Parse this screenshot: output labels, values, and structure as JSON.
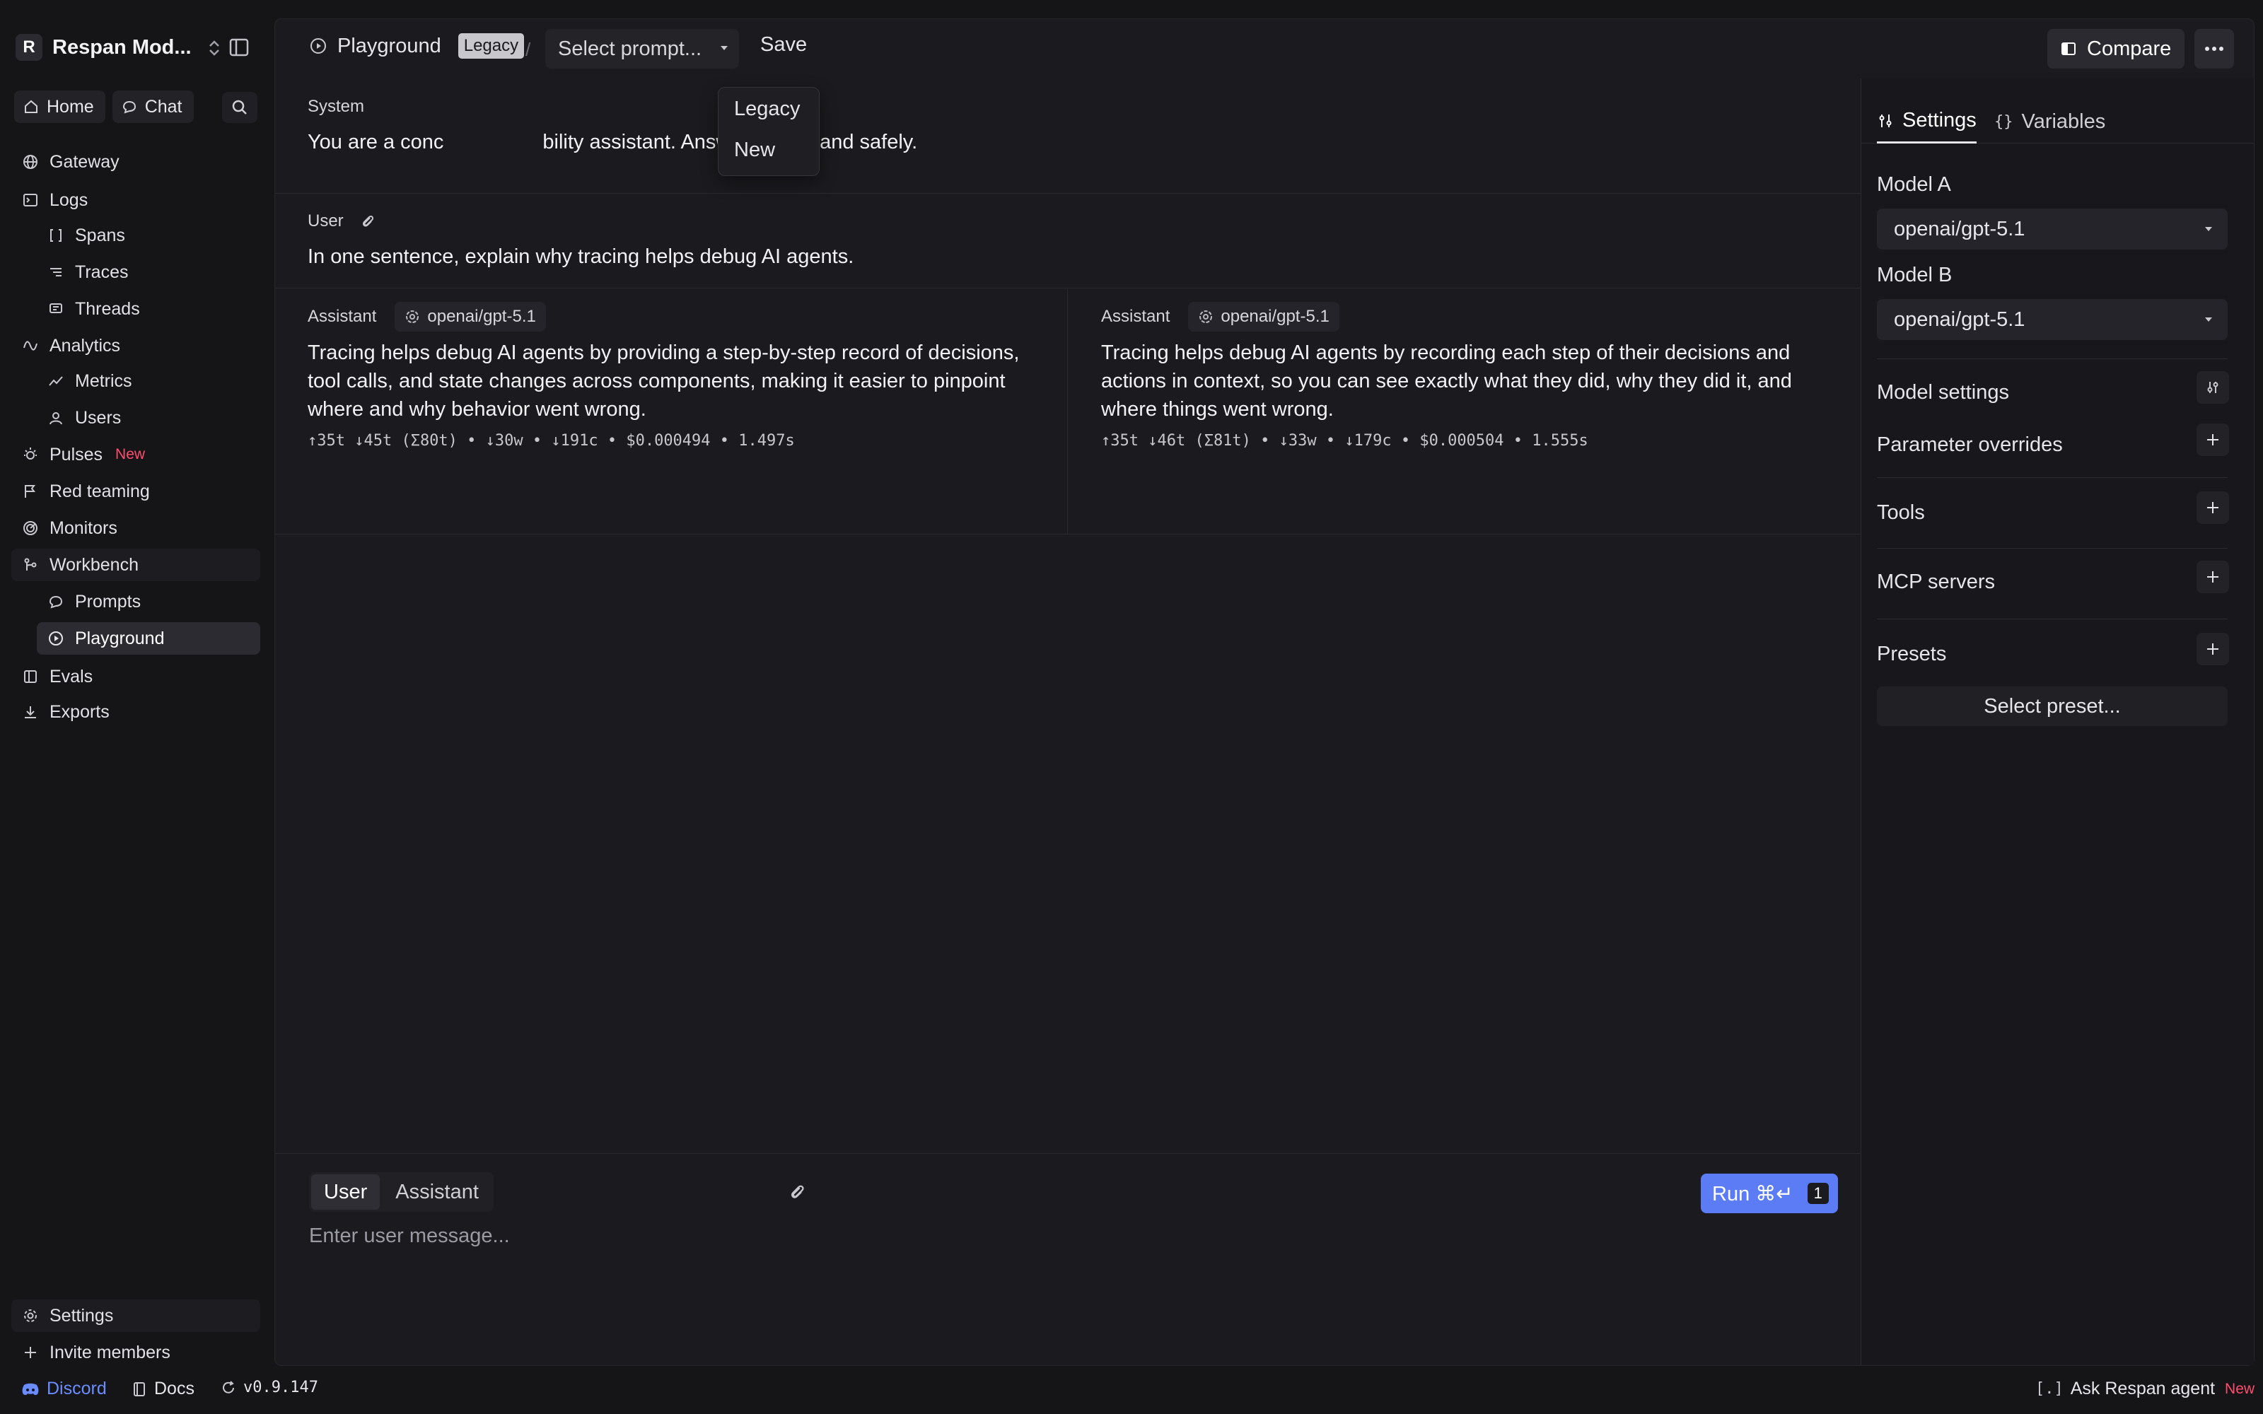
{
  "sidebar": {
    "workspace_initial": "R",
    "workspace_name": "Respan Mod...",
    "quick": {
      "home": "Home",
      "chat": "Chat"
    },
    "items": {
      "gateway": "Gateway",
      "logs": "Logs",
      "spans": "Spans",
      "traces": "Traces",
      "threads": "Threads",
      "analytics": "Analytics",
      "metrics": "Metrics",
      "users": "Users",
      "pulses": "Pulses",
      "pulses_badge": "New",
      "red_teaming": "Red teaming",
      "monitors": "Monitors",
      "workbench": "Workbench",
      "prompts": "Prompts",
      "playground": "Playground",
      "evals": "Evals",
      "exports": "Exports"
    },
    "bottom": {
      "settings": "Settings",
      "invite": "Invite members"
    }
  },
  "header": {
    "crumb": "Playground",
    "tag": "Legacy",
    "separator": "/",
    "prompt_select": "Select prompt...",
    "save": "Save",
    "compare": "Compare"
  },
  "dropdown": {
    "options": [
      "Legacy",
      "New"
    ]
  },
  "conversation": {
    "system": {
      "label": "System",
      "text_start": "You are a conc",
      "text_end": "bility assistant. Answer clearly and safely."
    },
    "user": {
      "label": "User",
      "text": "In one sentence, explain why tracing helps debug AI agents."
    },
    "responses": [
      {
        "label": "Assistant",
        "model": "openai/gpt-5.1",
        "lines": [
          "Tracing helps debug AI agents by providing a step-by-step record of decisions,",
          "tool calls, and state changes across components, making it easier to pinpoint",
          "where and why behavior went wrong."
        ],
        "stats": "↑35t ↓45t (Σ80t) • ↓30w • ↓191c • $0.000494 • 1.497s"
      },
      {
        "label": "Assistant",
        "model": "openai/gpt-5.1",
        "lines": [
          "Tracing helps debug AI agents by recording each step of their decisions and",
          "actions in context, so you can see exactly what they did, why they did it, and",
          "where things went wrong."
        ],
        "stats": "↑35t ↓46t (Σ81t) • ↓33w • ↓179c • $0.000504 • 1.555s"
      }
    ]
  },
  "composer": {
    "roles": [
      "User",
      "Assistant"
    ],
    "run_label": "Run ⌘↵",
    "run_key": "1",
    "placeholder": "Enter user message..."
  },
  "settings_panel": {
    "tabs": [
      "Settings",
      "Variables"
    ],
    "model_a_label": "Model A",
    "model_a_value": "openai/gpt-5.1",
    "model_b_label": "Model B",
    "model_b_value": "openai/gpt-5.1",
    "model_settings": "Model settings",
    "parameter_overrides": "Parameter overrides",
    "tools": "Tools",
    "mcp_servers": "MCP servers",
    "presets": "Presets",
    "select_preset": "Select preset..."
  },
  "footer": {
    "discord": "Discord",
    "docs": "Docs",
    "version": "v0.9.147",
    "agent_prefix": "[.]",
    "agent": "Ask Respan agent",
    "agent_badge": "New"
  },
  "colors": {
    "background": "#151518",
    "panel": "#1b1b1f",
    "accent": "#5b7cf5",
    "new_badge": "#ff4d6d",
    "discord": "#6b8cff"
  }
}
